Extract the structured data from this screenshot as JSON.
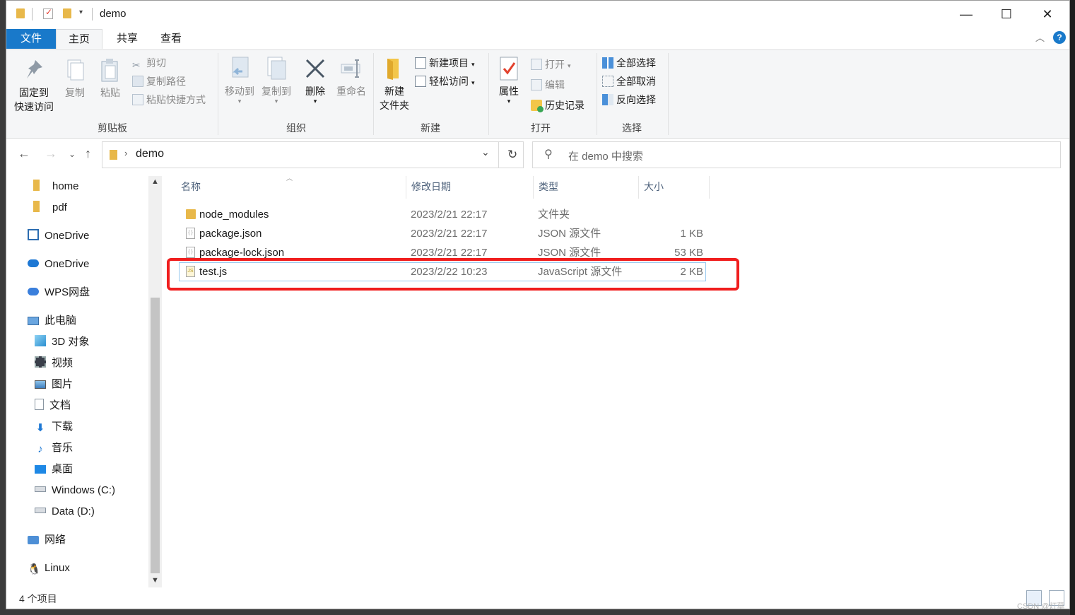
{
  "window": {
    "title": "demo",
    "controls": {
      "minimize": "—",
      "maximize": "☐",
      "close": "✕"
    }
  },
  "tabs": {
    "file": "文件",
    "home": "主页",
    "share": "共享",
    "view": "查看"
  },
  "help_label": "?",
  "ribbon": {
    "clipboard": {
      "label": "剪贴板",
      "pin": "固定到\n快速访问",
      "pin_line1": "固定到",
      "pin_line2": "快速访问",
      "copy": "复制",
      "paste": "粘贴",
      "cut": "剪切",
      "copy_path": "复制路径",
      "paste_shortcut": "粘贴快捷方式"
    },
    "organize": {
      "label": "组织",
      "move_to": "移动到",
      "copy_to": "复制到",
      "delete": "删除",
      "rename": "重命名"
    },
    "new": {
      "label": "新建",
      "new_folder_line1": "新建",
      "new_folder_line2": "文件夹",
      "new_item": "新建项目",
      "easy_access": "轻松访问"
    },
    "open": {
      "label": "打开",
      "properties": "属性",
      "open": "打开",
      "edit": "编辑",
      "history": "历史记录"
    },
    "select": {
      "label": "选择",
      "select_all": "全部选择",
      "select_none": "全部取消",
      "invert": "反向选择"
    }
  },
  "address": {
    "path": "demo",
    "search_placeholder": "在 demo 中搜索"
  },
  "nav": {
    "items": [
      {
        "label": "home",
        "icon": "folder-icon"
      },
      {
        "label": "pdf",
        "icon": "folder-icon"
      },
      {
        "label": "OneDrive",
        "icon": "onedrive-box-icon"
      },
      {
        "label": "OneDrive",
        "icon": "cloud-icon"
      },
      {
        "label": "WPS网盘",
        "icon": "wps-cloud-icon"
      },
      {
        "label": "此电脑",
        "icon": "computer-icon"
      },
      {
        "label": "3D 对象",
        "icon": "cube-icon"
      },
      {
        "label": "视频",
        "icon": "video-icon"
      },
      {
        "label": "图片",
        "icon": "picture-icon"
      },
      {
        "label": "文档",
        "icon": "document-icon"
      },
      {
        "label": "下载",
        "icon": "download-icon"
      },
      {
        "label": "音乐",
        "icon": "music-icon"
      },
      {
        "label": "桌面",
        "icon": "desktop-icon"
      },
      {
        "label": "Windows (C:)",
        "icon": "drive-c-icon"
      },
      {
        "label": "Data (D:)",
        "icon": "drive-d-icon"
      },
      {
        "label": "网络",
        "icon": "network-icon"
      },
      {
        "label": "Linux",
        "icon": "linux-icon"
      }
    ]
  },
  "columns": {
    "name": "名称",
    "modified": "修改日期",
    "type": "类型",
    "size": "大小"
  },
  "files": [
    {
      "name": "node_modules",
      "modified": "2023/2/21 22:17",
      "type": "文件夹",
      "size": "",
      "icon": "folder-icon"
    },
    {
      "name": "package.json",
      "modified": "2023/2/21 22:17",
      "type": "JSON 源文件",
      "size": "1 KB",
      "icon": "json-file-icon"
    },
    {
      "name": "package-lock.json",
      "modified": "2023/2/21 22:17",
      "type": "JSON 源文件",
      "size": "53 KB",
      "icon": "json-file-icon"
    },
    {
      "name": "test.js",
      "modified": "2023/2/22 10:23",
      "type": "JavaScript 源文件",
      "size": "2 KB",
      "icon": "js-file-icon",
      "selected": true
    }
  ],
  "status": {
    "count": "4 个项目"
  },
  "watermark": "CSDN @灯草",
  "colors": {
    "accent": "#1979ca",
    "highlight": "#f01e1e",
    "folder": "#e8b84a"
  }
}
